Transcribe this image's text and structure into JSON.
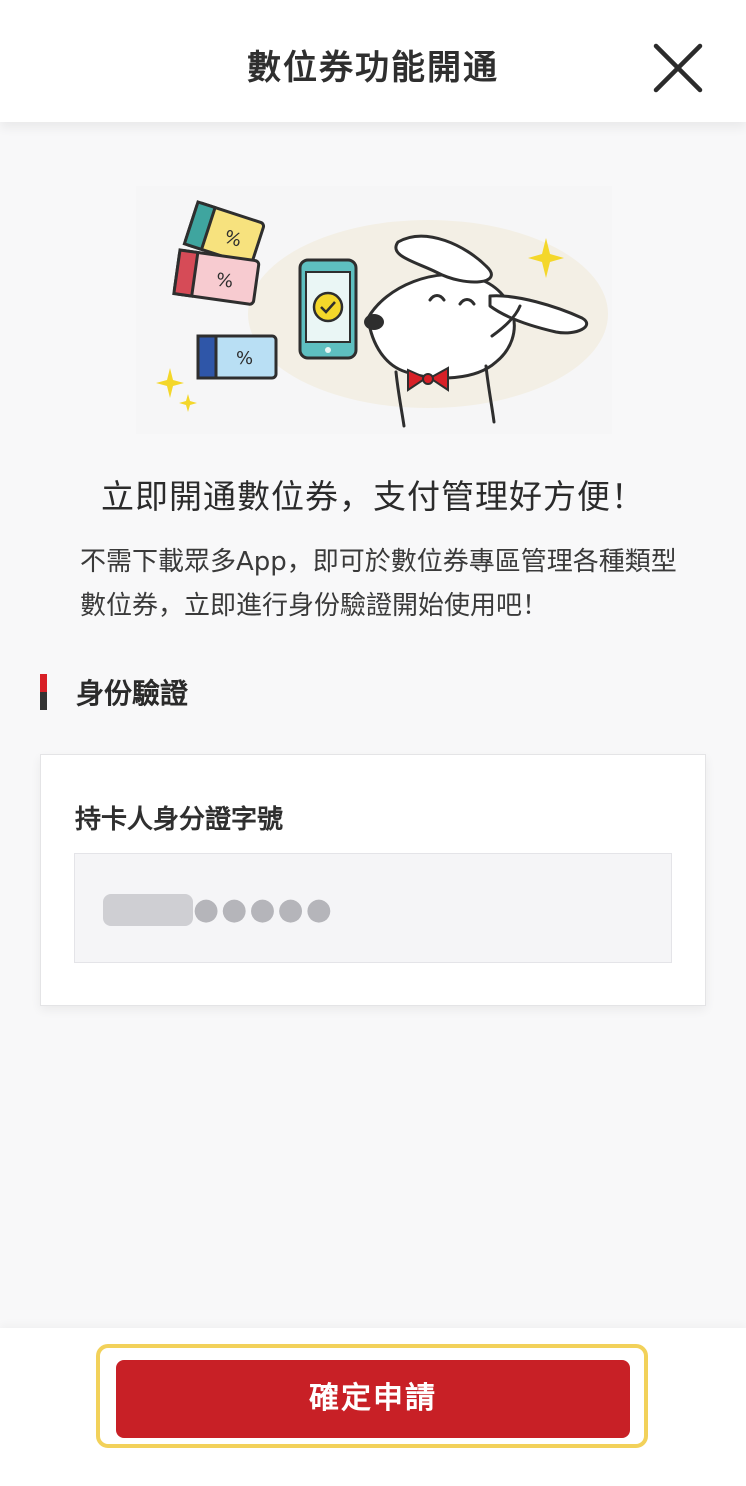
{
  "header": {
    "title": "數位券功能開通",
    "close_icon": "close-icon"
  },
  "hero": {
    "illustration": "dog-holding-phone-with-coupons-illustration"
  },
  "intro": {
    "headline": "立即開通數位券，支付管理好方便！",
    "description": "不需下載眾多App，即可於數位券專區管理各種類型數位券，立即進行身份驗證開始使用吧！"
  },
  "section": {
    "title": "身份驗證"
  },
  "form": {
    "id_label": "持卡人身分證字號",
    "id_masked_value": "●●●●●"
  },
  "footer": {
    "confirm_label": "確定申請"
  },
  "colors": {
    "accent_red": "#c82026",
    "highlight_yellow": "#f2d15a"
  }
}
